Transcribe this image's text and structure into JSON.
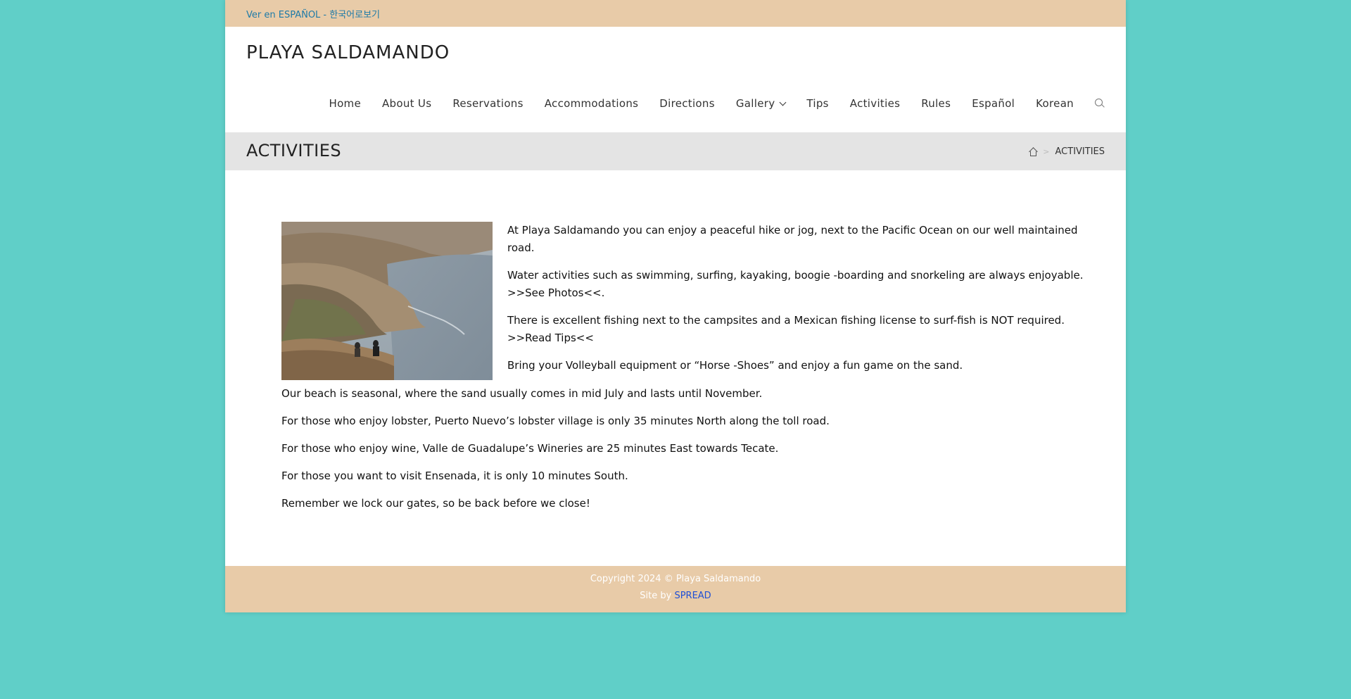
{
  "colors": {
    "page_background": "#60cfc8",
    "topbar_background": "#e8cba8",
    "footer_background": "#e8cba8",
    "link_blue": "#1e7aa7",
    "credit_link": "#1f4fd6"
  },
  "topbar": {
    "language_link": "Ver en ESPAÑOL - 한국어로보기"
  },
  "header": {
    "site_title": "PLAYA SALDAMANDO",
    "nav": [
      {
        "label": "Home"
      },
      {
        "label": "About Us"
      },
      {
        "label": "Reservations"
      },
      {
        "label": "Accommodations"
      },
      {
        "label": "Directions"
      },
      {
        "label": "Gallery",
        "icon": "chevron-down-icon"
      },
      {
        "label": "Tips"
      },
      {
        "label": "Activities"
      },
      {
        "label": "Rules"
      },
      {
        "label": "Español"
      },
      {
        "label": "Korean"
      }
    ],
    "search_icon": "search-icon"
  },
  "page_header": {
    "title": "ACTIVITIES",
    "breadcrumb_home_icon": "home-icon",
    "breadcrumb_separator": ">",
    "breadcrumb_current": "ACTIVITIES"
  },
  "content": {
    "image_alt": "Hikers sitting on a cliff overlooking the Pacific coastline",
    "paragraphs_right": [
      "At Playa Saldamando you can enjoy a peaceful hike or jog, next to the Pacific Ocean on our well maintained road.",
      "Water activities such as swimming, surfing, kayaking, boogie -boarding and snorkeling are always enjoyable.",
      ">>See Photos<<.",
      "There is excellent fishing next to the campsites and a Mexican fishing license to surf-fish is NOT required.",
      ">>Read Tips<<",
      "Bring your Volleyball equipment or “Horse -Shoes” and enjoy a fun game on the sand."
    ],
    "paragraphs_full": [
      "Our beach is seasonal, where the sand usually comes in mid July and lasts until November.",
      "For those who enjoy lobster, Puerto Nuevo’s lobster village is only 35 minutes North along the toll road.",
      "For those who enjoy wine, Valle de Guadalupe’s Wineries are 25 minutes East towards Tecate.",
      "For those you want to visit Ensenada, it is only 10 minutes South.",
      "Remember we lock our gates, so be back before we close!"
    ]
  },
  "footer": {
    "copyright": "Copyright 2024 © Playa Saldamando",
    "credit_prefix": "Site by ",
    "credit_link": "SPREAD"
  }
}
